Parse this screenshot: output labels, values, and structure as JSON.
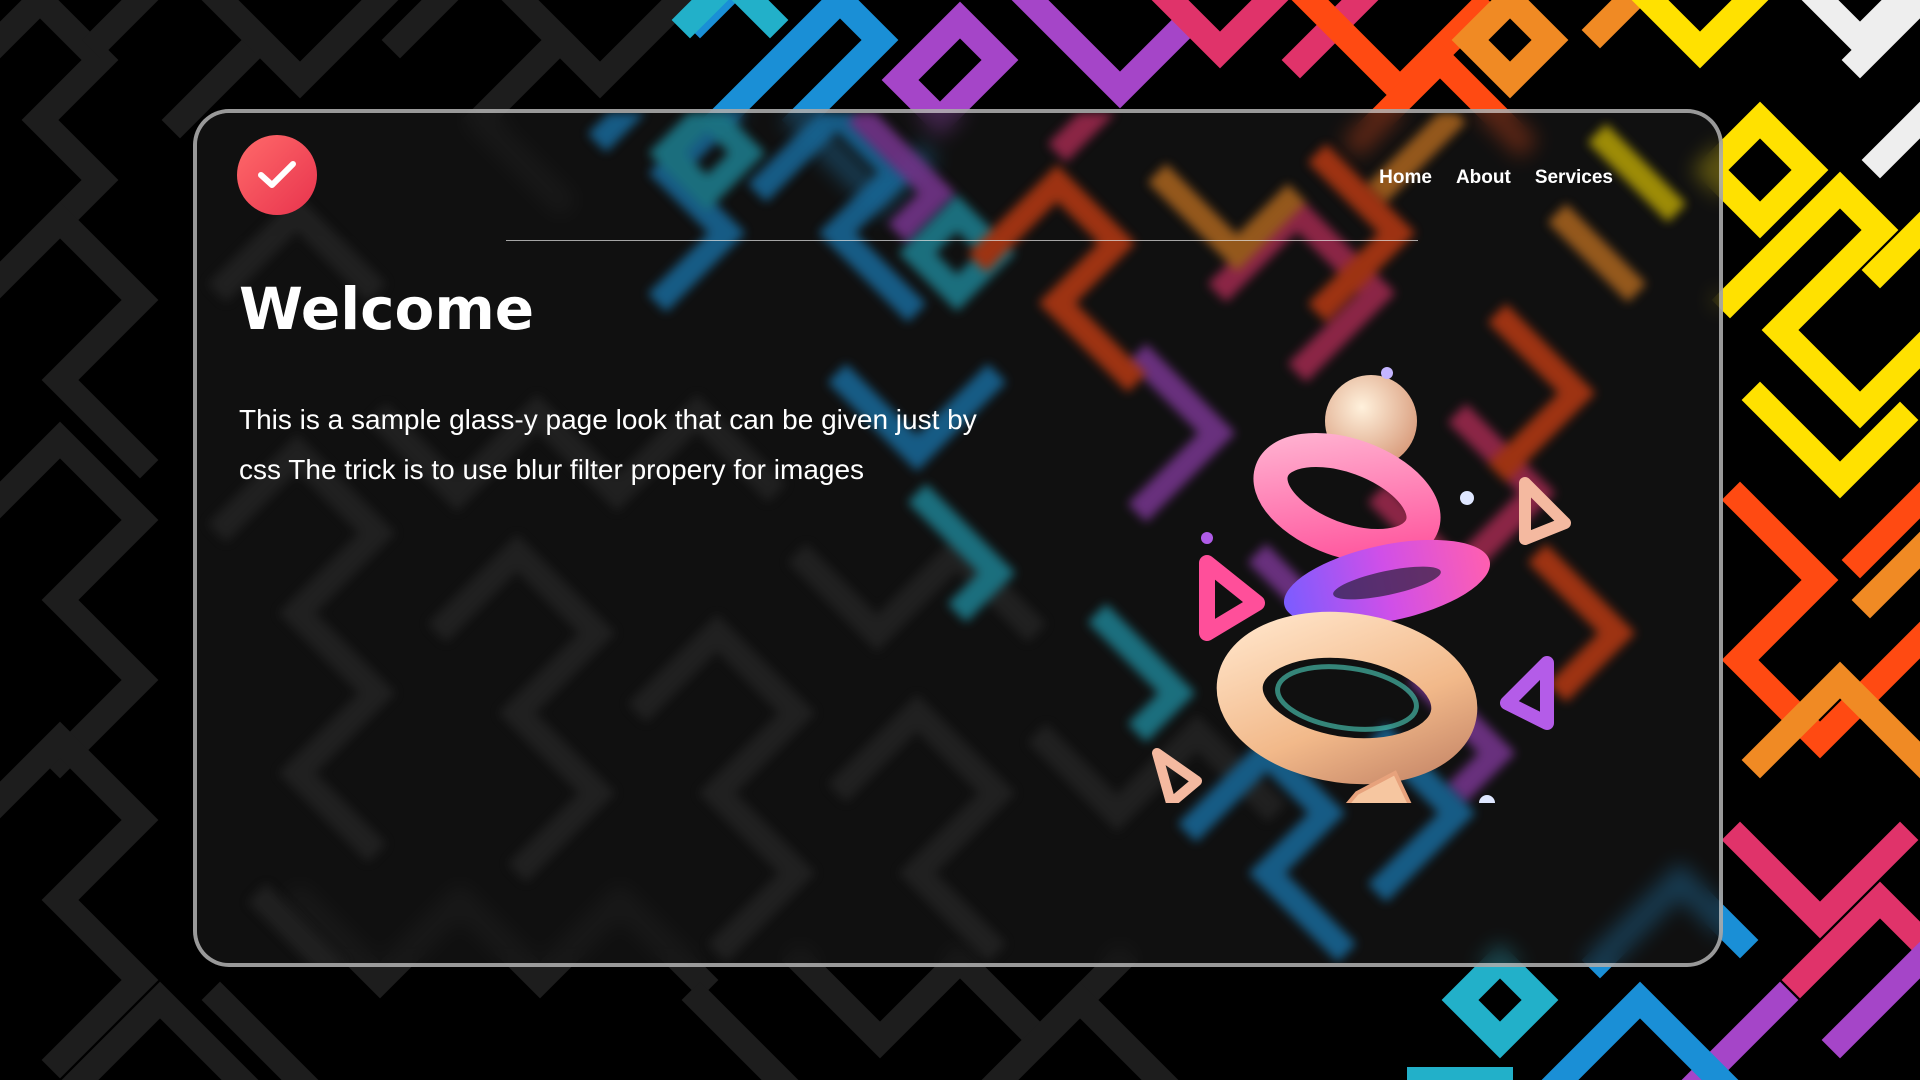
{
  "logo": {
    "icon": "checkmark-icon",
    "color": "#f0454f"
  },
  "nav": {
    "items": [
      {
        "label": "Home"
      },
      {
        "label": "About"
      },
      {
        "label": "Services"
      }
    ]
  },
  "hero": {
    "title": "Welcome",
    "description": "This is a sample glass-y page look that can be given just by css The trick is to use blur filter propery for images"
  },
  "colors": {
    "background": "#000000",
    "pattern_gray": "#1f1f1f",
    "card_border": "#c8c8c8",
    "accent_red": "#f0454f"
  }
}
